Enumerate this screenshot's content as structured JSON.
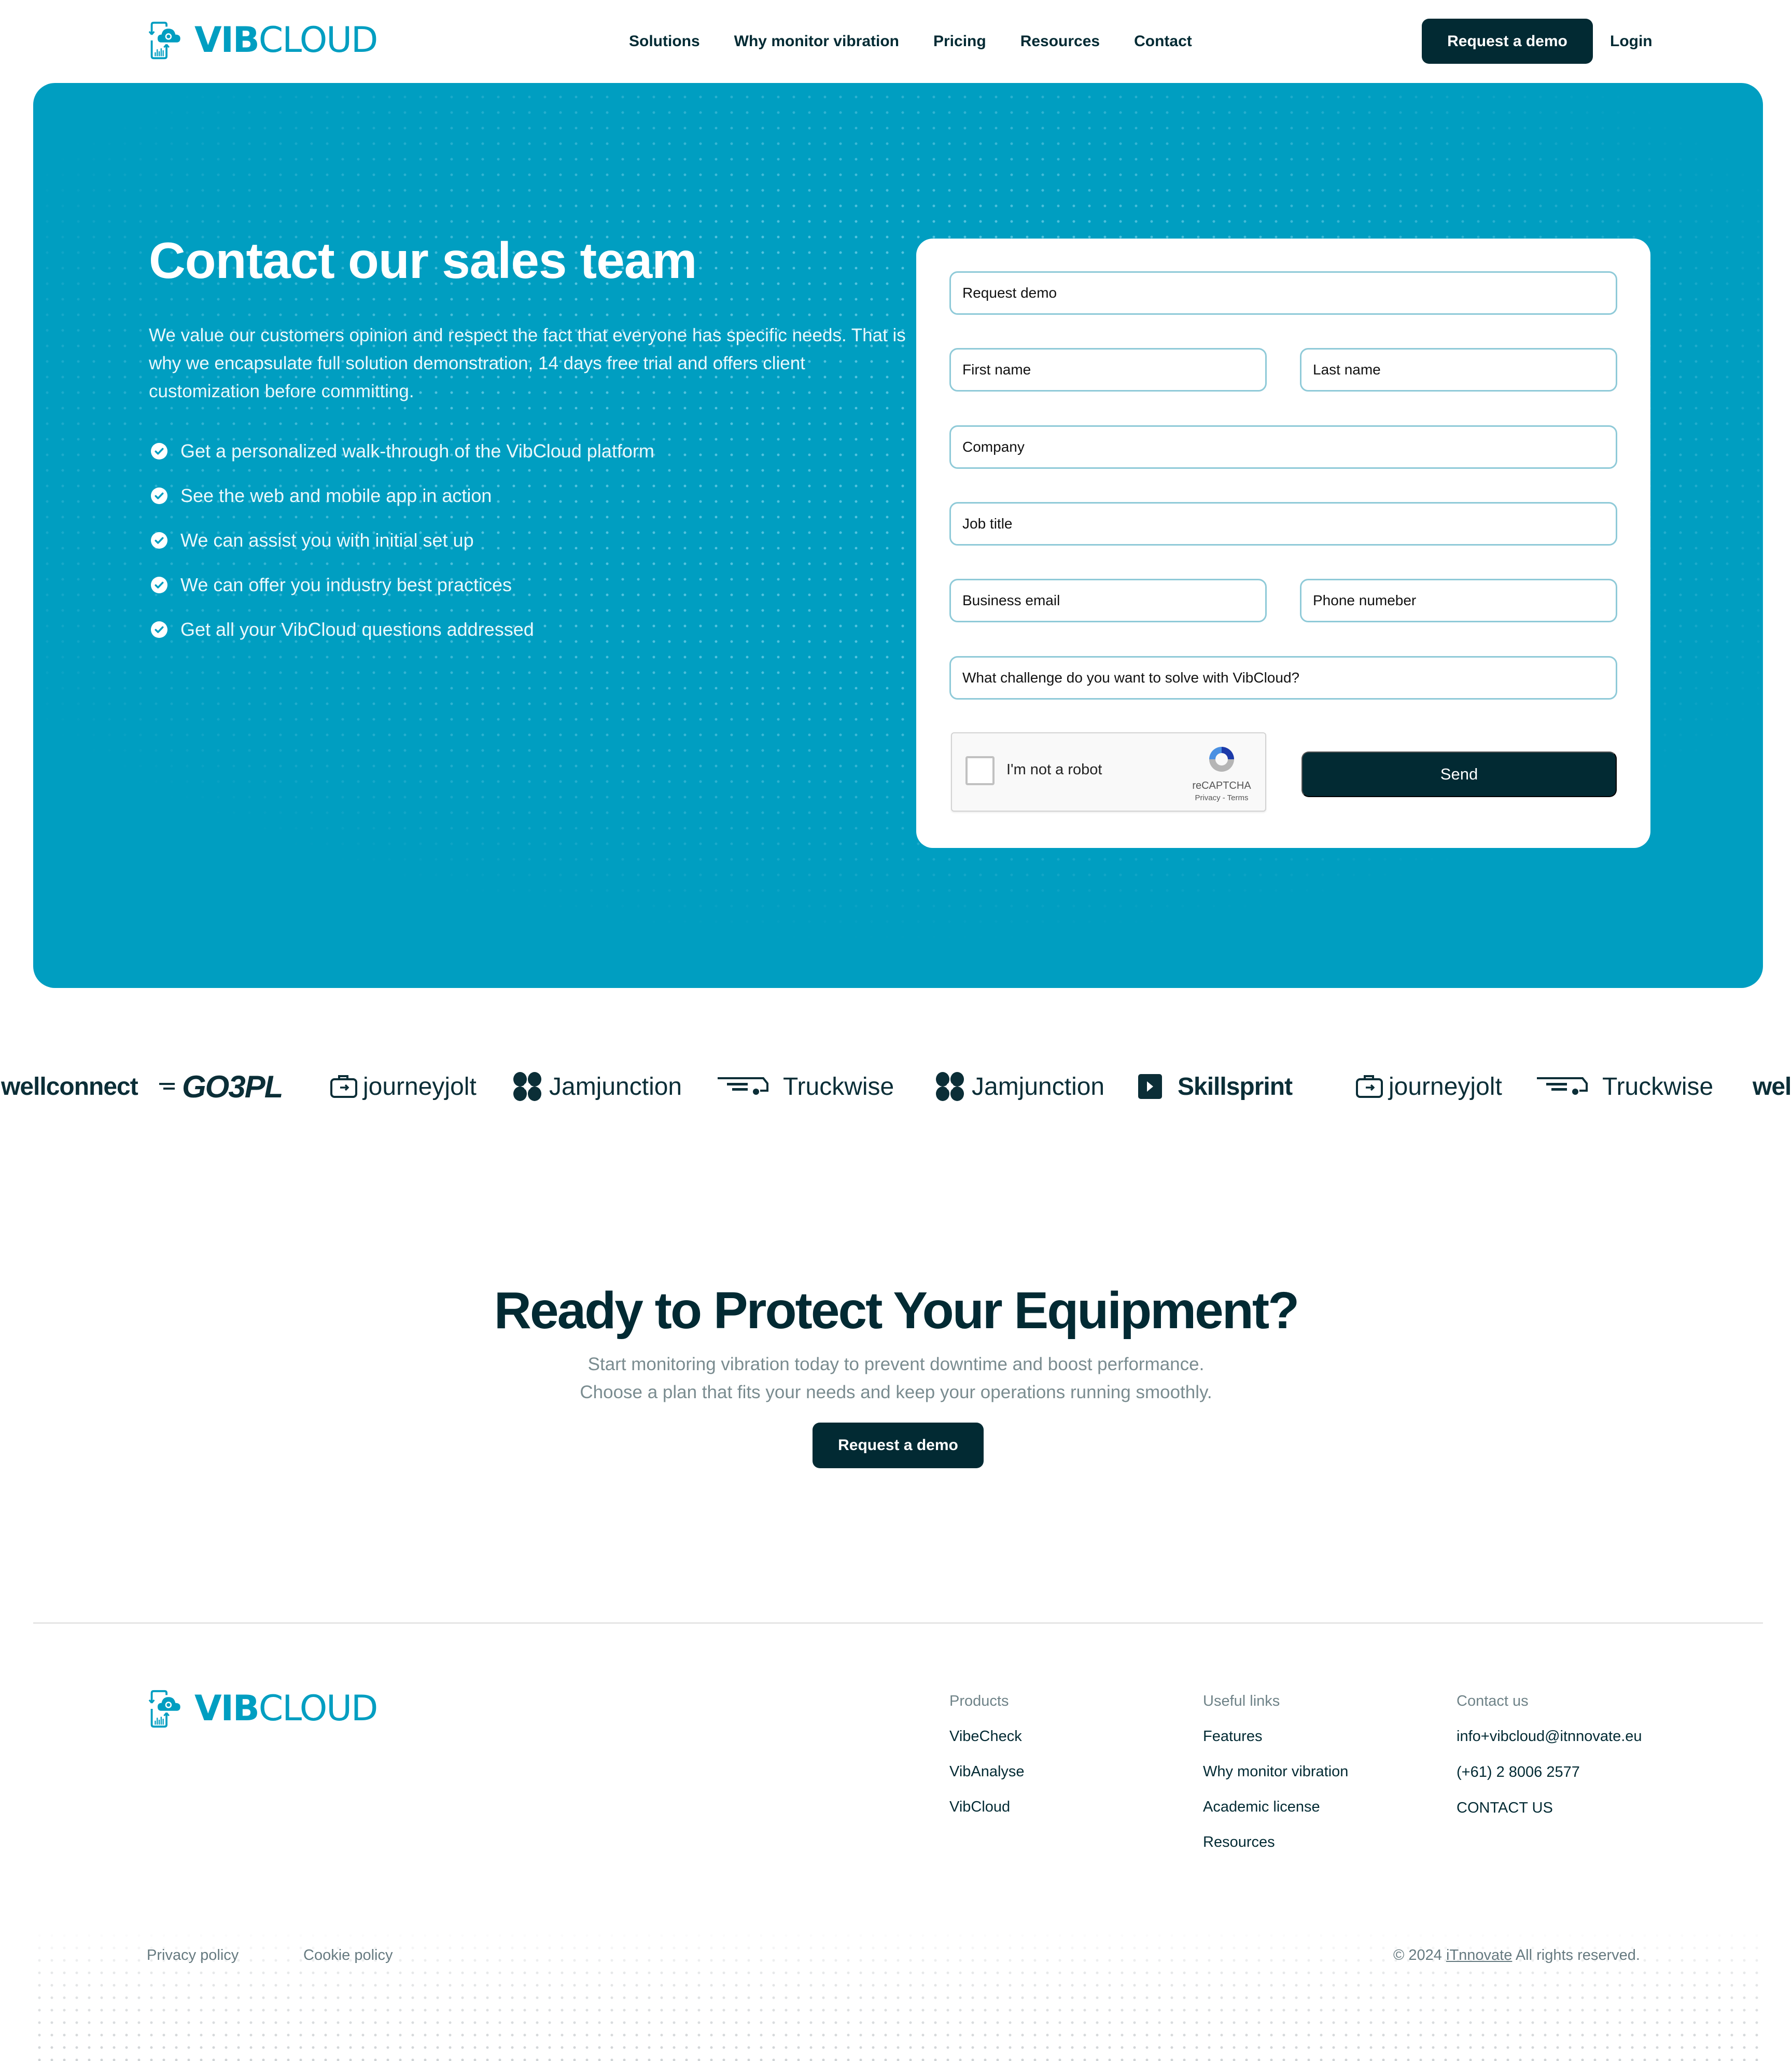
{
  "brand": {
    "bold": "VIB",
    "light": "CLOUD",
    "color": "#009ec1"
  },
  "nav": {
    "links": [
      "Solutions",
      "Why monitor vibration",
      "Pricing",
      "Resources",
      "Contact"
    ],
    "demo_button": "Request a demo",
    "login": "Login"
  },
  "hero": {
    "title": "Contact our sales team",
    "description": "We value our customers opinion and respect the fact that everyone has specific needs. That is why we encapsulate full solution demonstration, 14 days free trial and offers client customization before committing.",
    "bullets": [
      "Get a personalized walk-through of the VibCloud platform",
      "See the web and mobile app in action",
      "We can assist you with initial set up",
      "We can offer you industry best practices",
      "Get all your VibCloud questions addressed"
    ],
    "background_color": "#009ec1"
  },
  "form": {
    "request_type": "Request demo",
    "first_name_placeholder": "First name",
    "last_name_placeholder": "Last name",
    "company_placeholder": "Company",
    "job_title_placeholder": "Job title",
    "email_placeholder": "Business email",
    "phone_placeholder": "Phone numeber",
    "challenge_placeholder": "What challenge do you want to solve with VibCloud?",
    "captcha": {
      "label": "I'm not a robot",
      "brand": "reCAPTCHA",
      "links": "Privacy - Terms"
    },
    "send_button": "Send"
  },
  "partners": [
    {
      "name": "wellconnect",
      "icon": "none"
    },
    {
      "name": "GO3PL",
      "icon": "speed-lines-icon"
    },
    {
      "name": "journeyjolt",
      "icon": "journeyjolt-logo-icon"
    },
    {
      "name": "Jamjunction",
      "icon": "jamjunction-logo-icon"
    },
    {
      "name": "Truckwise",
      "icon": "truck-lines-icon"
    },
    {
      "name": "Jamjunction",
      "icon": "jamjunction-logo-icon"
    },
    {
      "name": "Skillsprint",
      "icon": "play-square-icon"
    },
    {
      "name": "journeyjolt",
      "icon": "journeyjolt-logo-icon"
    },
    {
      "name": "Truckwise",
      "icon": "truck-lines-icon"
    },
    {
      "name": "well",
      "icon": "none"
    }
  ],
  "cta": {
    "title": "Ready to Protect Your Equipment?",
    "subtitle_line1": "Start monitoring vibration today to prevent downtime and boost performance.",
    "subtitle_line2": "Choose a plan that fits your needs and keep your operations running smoothly.",
    "button": "Request a demo"
  },
  "footer": {
    "products": {
      "heading": "Products",
      "items": [
        "VibeCheck",
        "VibAnalyse",
        "VibCloud"
      ]
    },
    "useful_links": {
      "heading": "Useful links",
      "items": [
        "Features",
        "Why monitor vibration",
        "Academic license",
        "Resources"
      ]
    },
    "contact": {
      "heading": "Contact us",
      "email": "info+vibcloud@itnnovate.eu",
      "phone": "(+61) 2 8006 2577",
      "link": "CONTACT US"
    },
    "privacy": "Privacy policy",
    "cookie": "Cookie policy",
    "copyright_prefix": "© 2024",
    "copyright_company": "iTnnovate",
    "copyright_suffix": "All rights reserved."
  }
}
